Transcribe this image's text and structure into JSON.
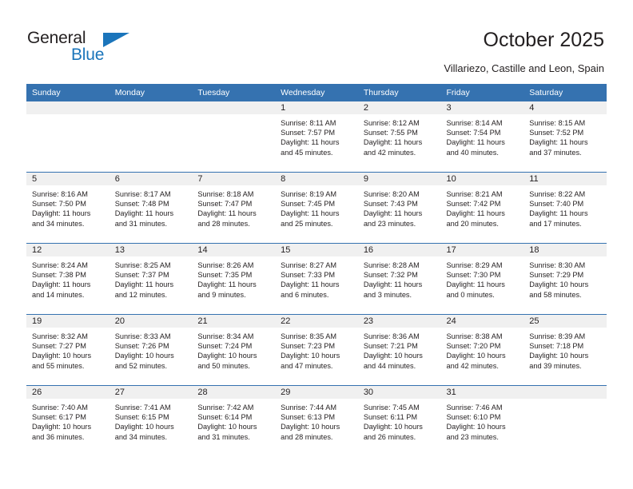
{
  "brand": {
    "name_part1": "General",
    "name_part2": "Blue",
    "flag_icon": "triangle-flag-icon"
  },
  "header": {
    "title": "October 2025",
    "subtitle": "Villariezo, Castille and Leon, Spain"
  },
  "colors": {
    "header_row_bg": "#3572b0",
    "brand_blue": "#1b75bb",
    "daynum_band_bg": "#f0f0f0",
    "text": "#231f20"
  },
  "weekdays": [
    "Sunday",
    "Monday",
    "Tuesday",
    "Wednesday",
    "Thursday",
    "Friday",
    "Saturday"
  ],
  "weeks": [
    [
      {
        "day": "",
        "sunrise": "",
        "sunset": "",
        "daylight1": "",
        "daylight2": ""
      },
      {
        "day": "",
        "sunrise": "",
        "sunset": "",
        "daylight1": "",
        "daylight2": ""
      },
      {
        "day": "",
        "sunrise": "",
        "sunset": "",
        "daylight1": "",
        "daylight2": ""
      },
      {
        "day": "1",
        "sunrise": "Sunrise: 8:11 AM",
        "sunset": "Sunset: 7:57 PM",
        "daylight1": "Daylight: 11 hours",
        "daylight2": "and 45 minutes."
      },
      {
        "day": "2",
        "sunrise": "Sunrise: 8:12 AM",
        "sunset": "Sunset: 7:55 PM",
        "daylight1": "Daylight: 11 hours",
        "daylight2": "and 42 minutes."
      },
      {
        "day": "3",
        "sunrise": "Sunrise: 8:14 AM",
        "sunset": "Sunset: 7:54 PM",
        "daylight1": "Daylight: 11 hours",
        "daylight2": "and 40 minutes."
      },
      {
        "day": "4",
        "sunrise": "Sunrise: 8:15 AM",
        "sunset": "Sunset: 7:52 PM",
        "daylight1": "Daylight: 11 hours",
        "daylight2": "and 37 minutes."
      }
    ],
    [
      {
        "day": "5",
        "sunrise": "Sunrise: 8:16 AM",
        "sunset": "Sunset: 7:50 PM",
        "daylight1": "Daylight: 11 hours",
        "daylight2": "and 34 minutes."
      },
      {
        "day": "6",
        "sunrise": "Sunrise: 8:17 AM",
        "sunset": "Sunset: 7:48 PM",
        "daylight1": "Daylight: 11 hours",
        "daylight2": "and 31 minutes."
      },
      {
        "day": "7",
        "sunrise": "Sunrise: 8:18 AM",
        "sunset": "Sunset: 7:47 PM",
        "daylight1": "Daylight: 11 hours",
        "daylight2": "and 28 minutes."
      },
      {
        "day": "8",
        "sunrise": "Sunrise: 8:19 AM",
        "sunset": "Sunset: 7:45 PM",
        "daylight1": "Daylight: 11 hours",
        "daylight2": "and 25 minutes."
      },
      {
        "day": "9",
        "sunrise": "Sunrise: 8:20 AM",
        "sunset": "Sunset: 7:43 PM",
        "daylight1": "Daylight: 11 hours",
        "daylight2": "and 23 minutes."
      },
      {
        "day": "10",
        "sunrise": "Sunrise: 8:21 AM",
        "sunset": "Sunset: 7:42 PM",
        "daylight1": "Daylight: 11 hours",
        "daylight2": "and 20 minutes."
      },
      {
        "day": "11",
        "sunrise": "Sunrise: 8:22 AM",
        "sunset": "Sunset: 7:40 PM",
        "daylight1": "Daylight: 11 hours",
        "daylight2": "and 17 minutes."
      }
    ],
    [
      {
        "day": "12",
        "sunrise": "Sunrise: 8:24 AM",
        "sunset": "Sunset: 7:38 PM",
        "daylight1": "Daylight: 11 hours",
        "daylight2": "and 14 minutes."
      },
      {
        "day": "13",
        "sunrise": "Sunrise: 8:25 AM",
        "sunset": "Sunset: 7:37 PM",
        "daylight1": "Daylight: 11 hours",
        "daylight2": "and 12 minutes."
      },
      {
        "day": "14",
        "sunrise": "Sunrise: 8:26 AM",
        "sunset": "Sunset: 7:35 PM",
        "daylight1": "Daylight: 11 hours",
        "daylight2": "and 9 minutes."
      },
      {
        "day": "15",
        "sunrise": "Sunrise: 8:27 AM",
        "sunset": "Sunset: 7:33 PM",
        "daylight1": "Daylight: 11 hours",
        "daylight2": "and 6 minutes."
      },
      {
        "day": "16",
        "sunrise": "Sunrise: 8:28 AM",
        "sunset": "Sunset: 7:32 PM",
        "daylight1": "Daylight: 11 hours",
        "daylight2": "and 3 minutes."
      },
      {
        "day": "17",
        "sunrise": "Sunrise: 8:29 AM",
        "sunset": "Sunset: 7:30 PM",
        "daylight1": "Daylight: 11 hours",
        "daylight2": "and 0 minutes."
      },
      {
        "day": "18",
        "sunrise": "Sunrise: 8:30 AM",
        "sunset": "Sunset: 7:29 PM",
        "daylight1": "Daylight: 10 hours",
        "daylight2": "and 58 minutes."
      }
    ],
    [
      {
        "day": "19",
        "sunrise": "Sunrise: 8:32 AM",
        "sunset": "Sunset: 7:27 PM",
        "daylight1": "Daylight: 10 hours",
        "daylight2": "and 55 minutes."
      },
      {
        "day": "20",
        "sunrise": "Sunrise: 8:33 AM",
        "sunset": "Sunset: 7:26 PM",
        "daylight1": "Daylight: 10 hours",
        "daylight2": "and 52 minutes."
      },
      {
        "day": "21",
        "sunrise": "Sunrise: 8:34 AM",
        "sunset": "Sunset: 7:24 PM",
        "daylight1": "Daylight: 10 hours",
        "daylight2": "and 50 minutes."
      },
      {
        "day": "22",
        "sunrise": "Sunrise: 8:35 AM",
        "sunset": "Sunset: 7:23 PM",
        "daylight1": "Daylight: 10 hours",
        "daylight2": "and 47 minutes."
      },
      {
        "day": "23",
        "sunrise": "Sunrise: 8:36 AM",
        "sunset": "Sunset: 7:21 PM",
        "daylight1": "Daylight: 10 hours",
        "daylight2": "and 44 minutes."
      },
      {
        "day": "24",
        "sunrise": "Sunrise: 8:38 AM",
        "sunset": "Sunset: 7:20 PM",
        "daylight1": "Daylight: 10 hours",
        "daylight2": "and 42 minutes."
      },
      {
        "day": "25",
        "sunrise": "Sunrise: 8:39 AM",
        "sunset": "Sunset: 7:18 PM",
        "daylight1": "Daylight: 10 hours",
        "daylight2": "and 39 minutes."
      }
    ],
    [
      {
        "day": "26",
        "sunrise": "Sunrise: 7:40 AM",
        "sunset": "Sunset: 6:17 PM",
        "daylight1": "Daylight: 10 hours",
        "daylight2": "and 36 minutes."
      },
      {
        "day": "27",
        "sunrise": "Sunrise: 7:41 AM",
        "sunset": "Sunset: 6:15 PM",
        "daylight1": "Daylight: 10 hours",
        "daylight2": "and 34 minutes."
      },
      {
        "day": "28",
        "sunrise": "Sunrise: 7:42 AM",
        "sunset": "Sunset: 6:14 PM",
        "daylight1": "Daylight: 10 hours",
        "daylight2": "and 31 minutes."
      },
      {
        "day": "29",
        "sunrise": "Sunrise: 7:44 AM",
        "sunset": "Sunset: 6:13 PM",
        "daylight1": "Daylight: 10 hours",
        "daylight2": "and 28 minutes."
      },
      {
        "day": "30",
        "sunrise": "Sunrise: 7:45 AM",
        "sunset": "Sunset: 6:11 PM",
        "daylight1": "Daylight: 10 hours",
        "daylight2": "and 26 minutes."
      },
      {
        "day": "31",
        "sunrise": "Sunrise: 7:46 AM",
        "sunset": "Sunset: 6:10 PM",
        "daylight1": "Daylight: 10 hours",
        "daylight2": "and 23 minutes."
      },
      {
        "day": "",
        "sunrise": "",
        "sunset": "",
        "daylight1": "",
        "daylight2": ""
      }
    ]
  ]
}
